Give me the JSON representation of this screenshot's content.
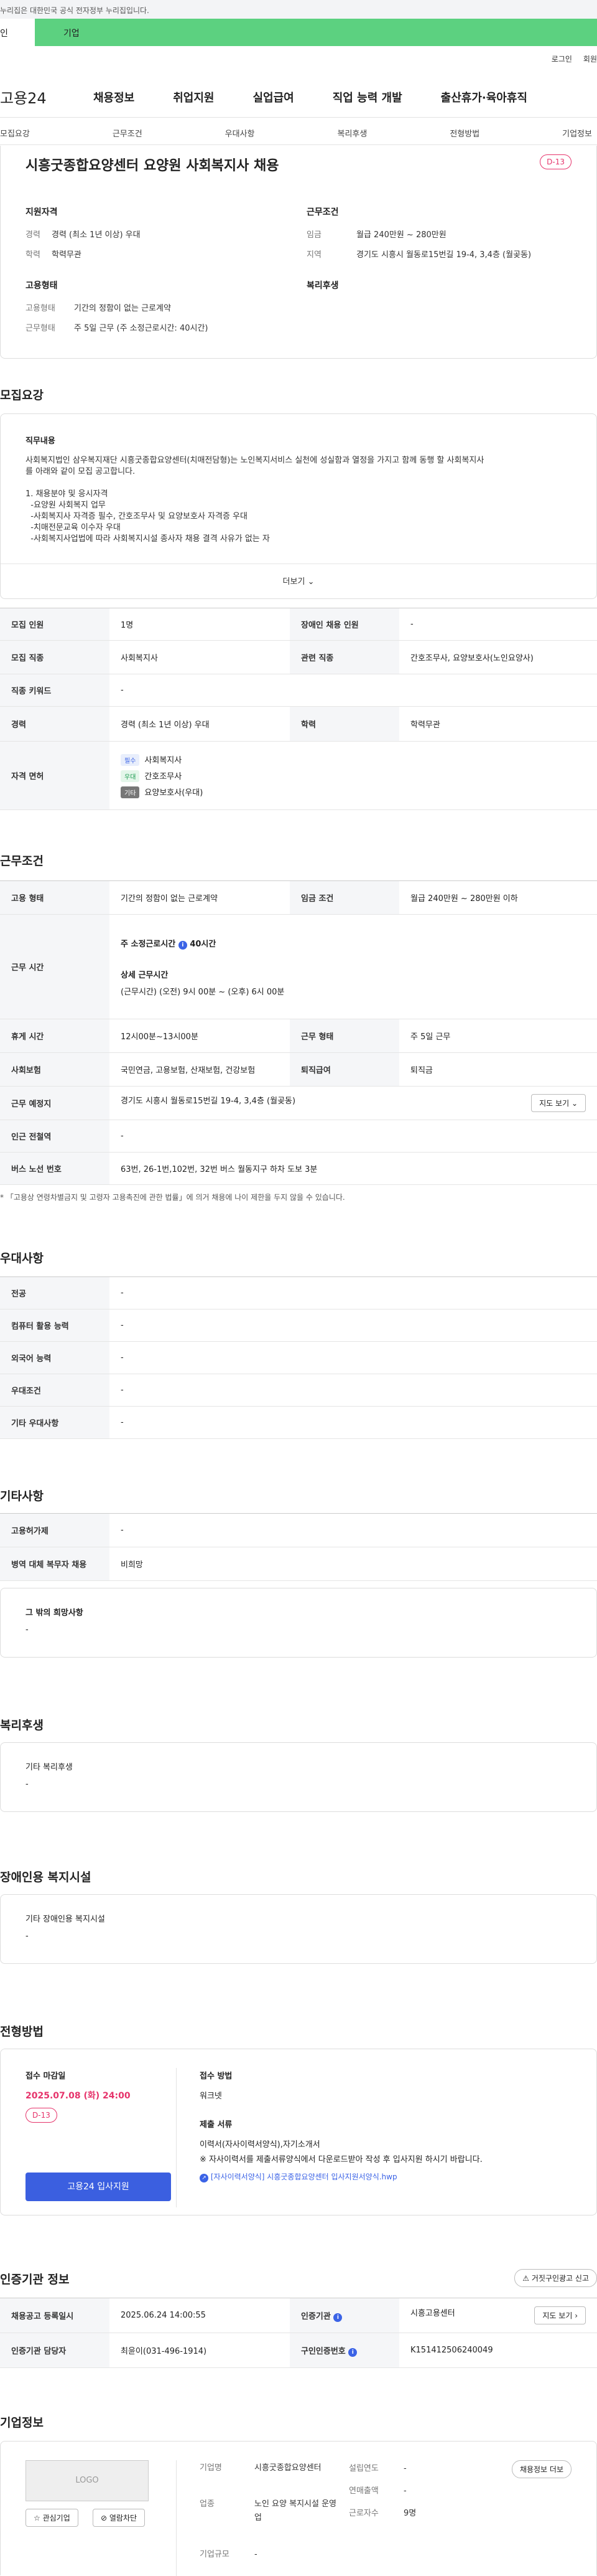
{
  "gov_banner": "누리집은 대한민국 공식 전자정부 누리집입니다.",
  "user_tabs": [
    "인",
    "기업"
  ],
  "toplinks": [
    "로그인",
    "회원"
  ],
  "logo": "고용24",
  "gnb": [
    "채용정보",
    "취업지원",
    "실업급여",
    "직업 능력 개발",
    "출산휴가·육아휴직"
  ],
  "subnav": [
    "모집요강",
    "근무조건",
    "우대사항",
    "복리후생",
    "전형방법",
    "기업정보"
  ],
  "job": {
    "title": "시흥굿종합요양센터 요양원 사회복지사 채용",
    "dday": "D-13",
    "qual_h": "지원자격",
    "career_k": "경력",
    "career_v": "경력 (최소 1년 이상) 우대",
    "edu_k": "학력",
    "edu_v": "학력무관",
    "cond_h": "근무조건",
    "pay_k": "임금",
    "pay_v": "월급 240만원 ~ 280만원",
    "region_k": "지역",
    "region_v": "경기도 시흥시 월동로15번길 19-4, 3,4층 (월곶동)",
    "emp_h": "고용형태",
    "etype_k": "고용형태",
    "etype_v": "기간의 정함이 없는 근로계약",
    "wtype_k": "근무형태",
    "wtype_v": "주 5일 근무 (주 소정근로시간: 40시간)",
    "welfare_h": "복리후생"
  },
  "recruit": {
    "heading": "모집요강",
    "duty_h": "직무내용",
    "duty_lines": [
      "사회복지법인 삼우복지재단 시흥굿종합요양센터(치매전담형)는 노인복지서비스 실천에 성실함과 열정을 가지고 함께 동행 할 사회복지사",
      "를 아래와 같이 모집 공고합니다.",
      "",
      "1. 채용분야 및 응시자격",
      "  -요양원 사회복지 업무",
      "  -사회복지사 자격증 필수, 간호조무사 및 요양보호사 자격증 우대",
      "  -치매전문교육 이수자 우대",
      "  -사회복지사업법에 따라 사회복지시설 종사자 채용 결격 사유가 없는 자"
    ],
    "more": "더보기",
    "rows": {
      "count_k": "모집 인원",
      "count_v": "1명",
      "disabled_k": "장애인 채용 인원",
      "disabled_v": "-",
      "job_k": "모집 직종",
      "job_v": "사회복지사",
      "rel_k": "관련 직종",
      "rel_v": "간호조무사, 요양보호사(노인요양사)",
      "kw_k": "직종 키워드",
      "kw_v": "-",
      "career_k": "경력",
      "career_v": "경력 (최소 1년 이상) 우대",
      "edu_k": "학력",
      "edu_v": "학력무관",
      "lic_k": "자격 면허",
      "licenses": [
        {
          "tag": "필수",
          "name": "사회복지사",
          "color": "#3b63e6",
          "bg": "#e8eefc"
        },
        {
          "tag": "우대",
          "name": "간호조무사",
          "color": "#1a9a4e",
          "bg": "#e4f6ea"
        },
        {
          "tag": "기타",
          "name": "요양보호사(우대)",
          "color": "#fff",
          "bg": "#777"
        }
      ]
    }
  },
  "cond": {
    "heading": "근무조건",
    "etype_k": "고용 형태",
    "etype_v": "기간의 정함이 없는 근로계약",
    "pay_k": "임금 조건",
    "pay_v": "월급 240만원 ~ 280만원 이하",
    "hours_k": "근무 시간",
    "weekly": "주 소정근로시간",
    "weekly_v": "40시간",
    "detail_h": "상세 근무시간",
    "detail_v": "(근무시간) (오전) 9시 00분 ~ (오후) 6시 00분",
    "rest_k": "휴게 시간",
    "rest_v": "12시00분~13시00분",
    "wtype_k": "근무 형태",
    "wtype_v": "주 5일 근무",
    "ins_k": "사회보험",
    "ins_v": "국민연금, 고용보험, 산재보험, 건강보험",
    "sev_k": "퇴직급여",
    "sev_v": "퇴직금",
    "place_k": "근무 예정지",
    "place_v": "경기도 시흥시 월동로15번길 19-4, 3,4층 (월곶동)",
    "map_btn": "지도 보기",
    "sub_k": "인근 전철역",
    "sub_v": "-",
    "bus_k": "버스 노선 번호",
    "bus_v": "63번, 26-1번,102번, 32번 버스 월동지구 하차 도보 3분",
    "note": "* 「고용상 연령차별금지 및 고령자 고용촉진에 관한 법률」에 의거 채용에 나이 제한을 두지 않을 수 있습니다."
  },
  "pref": {
    "heading": "우대사항",
    "rows": [
      {
        "k": "전공",
        "v": "-"
      },
      {
        "k": "컴퓨터 활용 능력",
        "v": "-"
      },
      {
        "k": "외국어 능력",
        "v": "-"
      },
      {
        "k": "우대조건",
        "v": "-"
      },
      {
        "k": "기타 우대사항",
        "v": "-"
      }
    ]
  },
  "etc": {
    "heading": "기타사항",
    "rows": [
      {
        "k": "고용허가제",
        "v": "-"
      },
      {
        "k": "병역 대체 복무자 채용",
        "v": "비희망"
      }
    ],
    "other_h": "그 밖의 희망사항",
    "other_v": "-"
  },
  "welfare": {
    "heading": "복리후생",
    "h": "기타 복리후생",
    "v": "-"
  },
  "facility": {
    "heading": "장애인용 복지시설",
    "h": "기타 장애인용 복지시설",
    "v": "-"
  },
  "screen": {
    "heading": "전형방법",
    "deadline_h": "접수 마감일",
    "deadline_v": "2025.07.08 (화) 24:00",
    "dday": "D-13",
    "apply_btn": "고용24 입사지원",
    "method_h": "접수 방법",
    "method_v": "워크넷",
    "docs_h": "제출 서류",
    "docs_v": "이력서(자사이력서양식),자기소개서",
    "docs_note": "※ 자사이력서를 제출서류양식에서 다운로드받아 작성 후 입사지원 하시기 바랍니다.",
    "docs_link": "[자사이력서양식] 시흥굿종합요양센터 입사지원서양식.hwp"
  },
  "cert": {
    "heading": "인증기관 정보",
    "report_btn": "거짓구인광고 신고",
    "reg_k": "채용공고 등록일시",
    "reg_v": "2025.06.24 14:00:55",
    "org_k": "인증기관",
    "org_v": "시흥고용센터",
    "map_btn": "지도 보기",
    "mgr_k": "인증기관 담당자",
    "mgr_v": "최윤이(031-496-1914)",
    "id_k": "구인인증번호",
    "id_v": "K151412506240049"
  },
  "company": {
    "heading": "기업정보",
    "logo_text": "LOGO",
    "fav_btn": "관심기업",
    "hide_btn": "열람차단",
    "name_k": "기업명",
    "name_v": "시흥굿종합요양센터",
    "ind_k": "업종",
    "ind_v": "노인 요양 복지시설 운영업",
    "size_k": "기업규모",
    "size_v": "-",
    "est_k": "설립연도",
    "est_v": "-",
    "sales_k": "연매출액",
    "sales_v": "-",
    "emp_k": "근로자수",
    "emp_v": "9명",
    "jobs_btn": "채용정보 더보"
  }
}
